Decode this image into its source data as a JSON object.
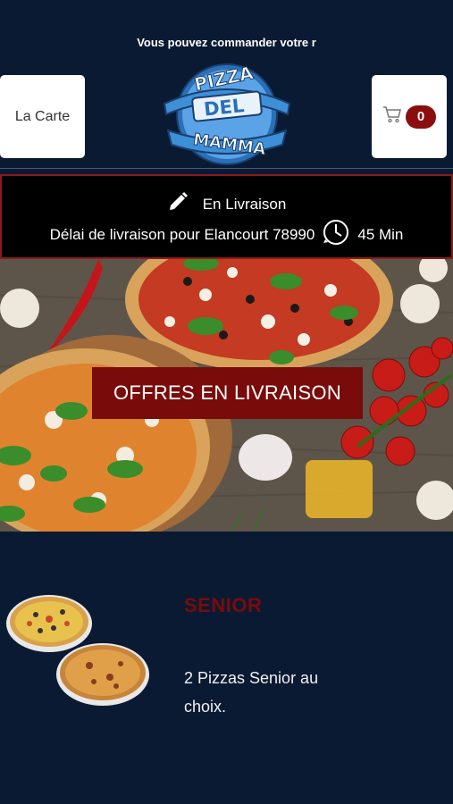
{
  "header": {
    "marquee": "Vous pouvez commander votre r",
    "carte_label": "La Carte",
    "cart_count": "0",
    "logo_text": [
      "PIZZA",
      "DEL",
      "MAMMA"
    ]
  },
  "delivery": {
    "mode": "En Livraison",
    "delay_text": "Délai de livraison pour Elancourt 78990",
    "delay_time": "45 Min"
  },
  "hero": {
    "button_label": "OFFRES EN LIVRAISON"
  },
  "product": {
    "title": "SENIOR",
    "description": "2 Pizzas Senior au choix."
  },
  "colors": {
    "background": "#0b1a33",
    "accent": "#7a0b0b",
    "logo_blue": "#3d8fd6"
  }
}
